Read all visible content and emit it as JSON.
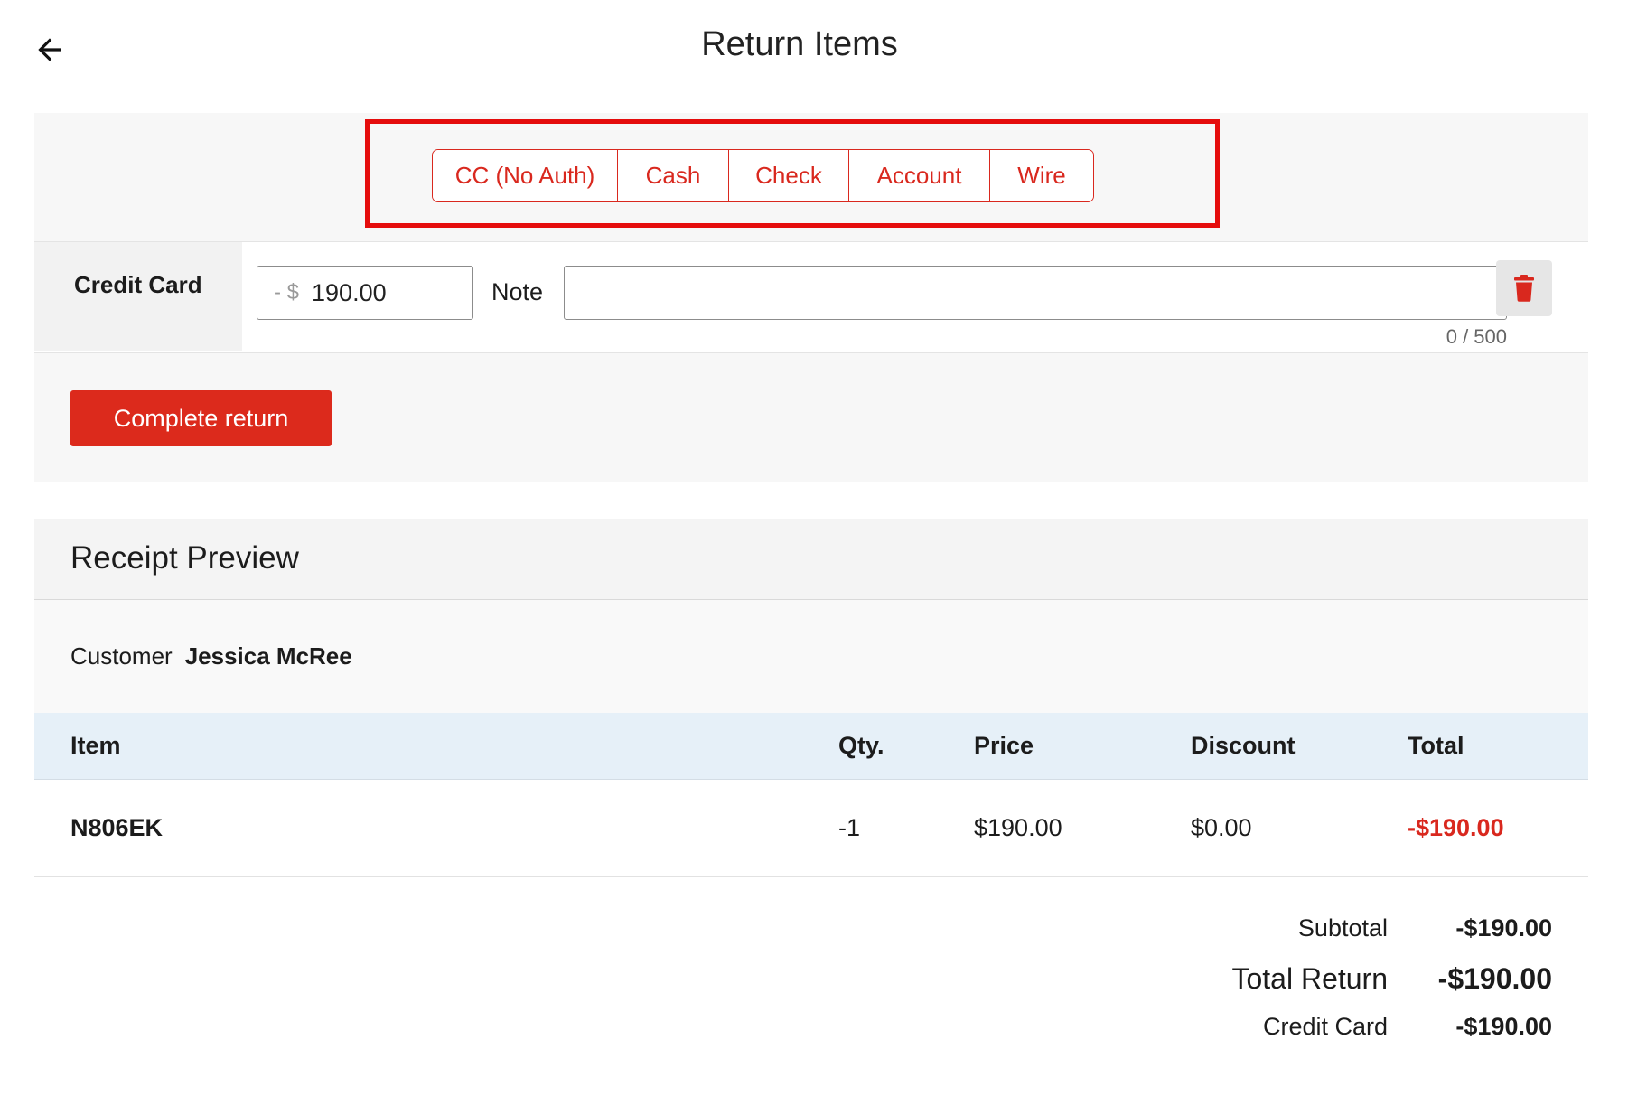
{
  "header": {
    "title": "Return Items"
  },
  "payment_methods": [
    "CC (No Auth)",
    "Cash",
    "Check",
    "Account",
    "Wire"
  ],
  "payment_line": {
    "label": "Credit Card",
    "amount_prefix": "- $",
    "amount_value": "190.00",
    "note_label": "Note",
    "note_value": "",
    "note_counter": "0 / 500"
  },
  "actions": {
    "complete_label": "Complete return"
  },
  "receipt": {
    "title": "Receipt Preview",
    "customer_label": "Customer",
    "customer_name": "Jessica McRee",
    "columns": {
      "item": "Item",
      "qty": "Qty.",
      "price": "Price",
      "discount": "Discount",
      "total": "Total"
    },
    "rows": [
      {
        "item": "N806EK",
        "qty": "-1",
        "price": "$190.00",
        "discount": "$0.00",
        "total": "-$190.00"
      }
    ],
    "summary": {
      "subtotal_label": "Subtotal",
      "subtotal_value": "-$190.00",
      "total_label": "Total Return",
      "total_value": "-$190.00",
      "credit_label": "Credit Card",
      "credit_value": "-$190.00"
    }
  },
  "colors": {
    "accent": "#dc2a1c",
    "highlight": "#e50d0d",
    "table_header_bg": "#e6f0f8"
  },
  "icons": {
    "back": "arrow-left-icon",
    "delete": "trash-icon"
  }
}
